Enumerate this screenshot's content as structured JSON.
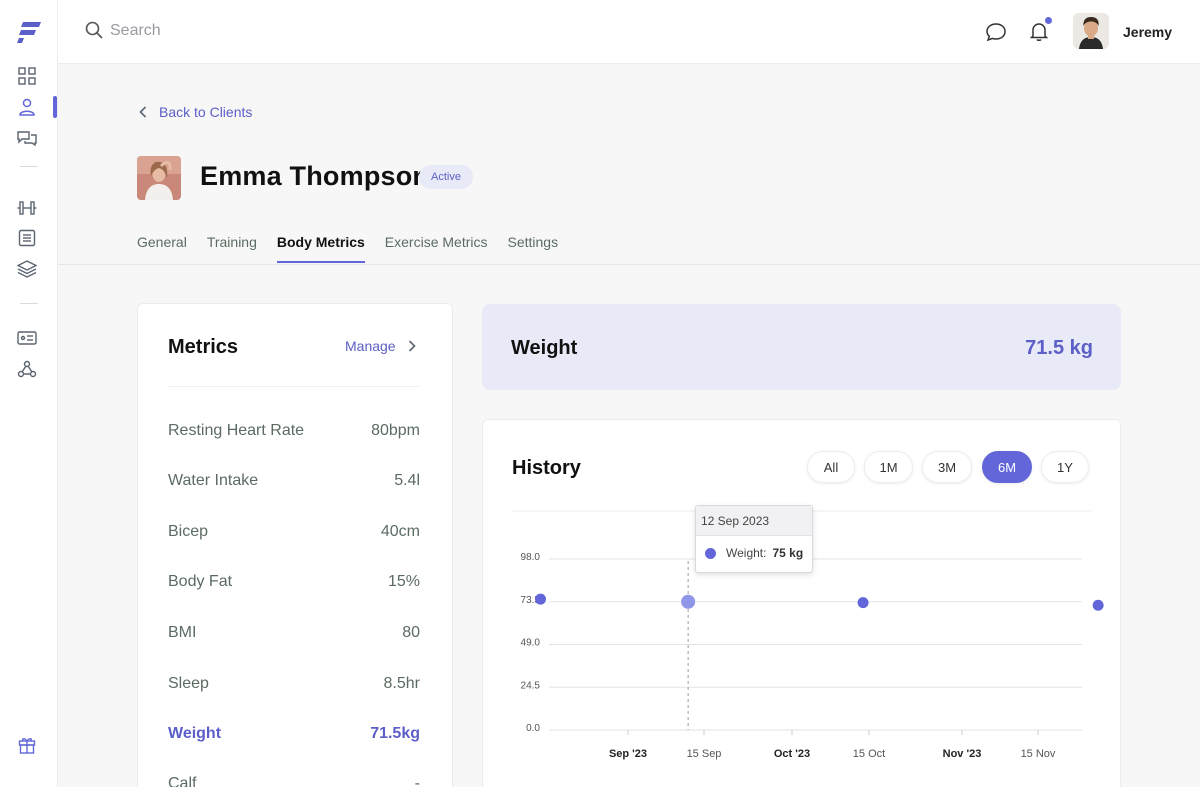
{
  "search": {
    "placeholder": "Search"
  },
  "user": {
    "name": "Jeremy"
  },
  "back_link": "Back to Clients",
  "client": {
    "name": "Emma Thompson",
    "status": "Active"
  },
  "tabs": [
    {
      "label": "General"
    },
    {
      "label": "Training"
    },
    {
      "label": "Body Metrics",
      "active": true
    },
    {
      "label": "Exercise Metrics"
    },
    {
      "label": "Settings"
    }
  ],
  "metrics": {
    "title": "Metrics",
    "manage_label": "Manage",
    "rows": [
      {
        "label": "Resting Heart Rate",
        "value": "80bpm"
      },
      {
        "label": "Water Intake",
        "value": "5.4l"
      },
      {
        "label": "Bicep",
        "value": "40cm"
      },
      {
        "label": "Body Fat",
        "value": "15%"
      },
      {
        "label": "BMI",
        "value": "80"
      },
      {
        "label": "Sleep",
        "value": "8.5hr"
      },
      {
        "label": "Weight",
        "value": "71.5kg"
      },
      {
        "label": "Calf",
        "value": "-"
      }
    ]
  },
  "weight_card": {
    "title": "Weight",
    "value": "71.5 kg"
  },
  "history": {
    "title": "History",
    "ranges": [
      "All",
      "1M",
      "3M",
      "6M",
      "1Y"
    ],
    "active_range": "6M"
  },
  "tooltip": {
    "date": "12 Sep 2023",
    "label": "Weight:",
    "value": "75 kg"
  },
  "colors": {
    "accent": "#6366d8",
    "accent_light": "#e9eaf7",
    "point_highlight": "#8f95e8"
  },
  "chart_data": {
    "type": "scatter",
    "ylim": [
      0,
      98
    ],
    "y_ticks": [
      "98.0",
      "73.5",
      "49.0",
      "24.5",
      "0.0"
    ],
    "x_ticks": [
      "Sep '23",
      "15 Sep",
      "Oct '23",
      "15 Oct",
      "Nov '23",
      "15 Nov"
    ],
    "x_tick_dates": [
      "2023-09-01",
      "2023-09-15",
      "2023-10-01",
      "2023-10-15",
      "2023-11-01",
      "2023-11-15"
    ],
    "series": [
      {
        "points": [
          {
            "x": "2023-08-16",
            "y": 75
          },
          {
            "x": "2023-09-12",
            "y": 73.5
          },
          {
            "x": "2023-10-14",
            "y": 73
          },
          {
            "x": "2023-11-26",
            "y": 71.5
          }
        ]
      }
    ],
    "highlighted_point": 1
  }
}
